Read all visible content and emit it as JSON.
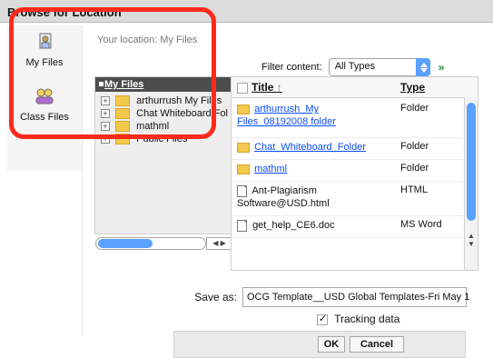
{
  "window": {
    "title": "Browse for Location"
  },
  "left_nav": {
    "my_files": "My Files",
    "class_files": "Class Files"
  },
  "main": {
    "location_text": "Your location: My Files",
    "filter": {
      "label": "Filter content:",
      "selected": "All Types"
    },
    "tree": {
      "header": "My Files",
      "items": [
        "arthurrush My Files",
        "Chat Whiteboard Fol",
        "mathml",
        "Public Files"
      ]
    },
    "files": {
      "headers": {
        "title": "Title",
        "type": "Type"
      },
      "rows": [
        {
          "title_line1": "arthurrush_My",
          "title_line2": "Files_08192008 folder",
          "type": "Folder"
        },
        {
          "title": "Chat_Whiteboard_Folder",
          "type": "Folder"
        },
        {
          "title": "mathml",
          "type": "Folder"
        },
        {
          "title_line1": "Ant-Plagiarism",
          "title_line2": "Software@USD.html",
          "type": "HTML"
        },
        {
          "title": "get_help_CE6.doc",
          "type": "MS Word"
        }
      ]
    },
    "save_as": {
      "label": "Save as:",
      "value": "OCG Template__USD Global Templates-Fri May 1"
    },
    "tracking": {
      "label": "Tracking data"
    },
    "buttons": {
      "ok": "OK",
      "cancel": "Cancel"
    }
  },
  "colors": {
    "highlight": "#ff2a1a",
    "accent": "#5aa0ff",
    "link": "#0b4cff"
  },
  "icons": {
    "my_files": "my-files-icon",
    "class_files": "class-files-icon",
    "folder": "folder-icon",
    "document": "document-icon",
    "go": "go-arrow-icon"
  }
}
